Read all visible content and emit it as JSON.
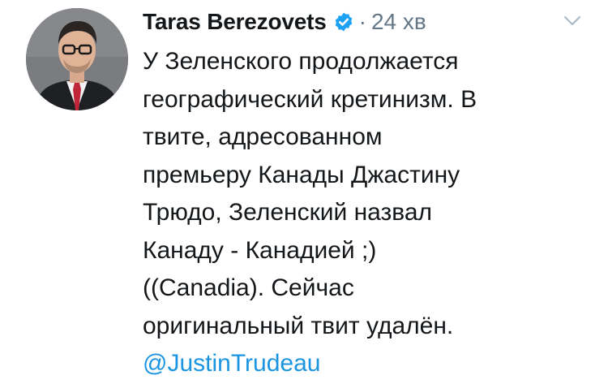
{
  "author": {
    "display_name": "Taras Berezovets",
    "verified": true,
    "separator": "·",
    "timestamp": "24 хв"
  },
  "menu": {
    "icon": "chevron-down-icon"
  },
  "tweet": {
    "lines": [
      "У Зеленского продолжается",
      "географический кретинизм. В",
      "твите, адресованном",
      "премьеру Канады Джастину",
      "Трюдо, Зеленский назвал",
      "Канаду - Канадией ;)",
      "((Canadia). Сейчас",
      "оригинальный твит удалён."
    ],
    "mention": "@JustinTrudeau"
  },
  "colors": {
    "text": "#14171a",
    "muted": "#657786",
    "link": "#1b95e0",
    "verified_badge": "#1da1f2"
  }
}
